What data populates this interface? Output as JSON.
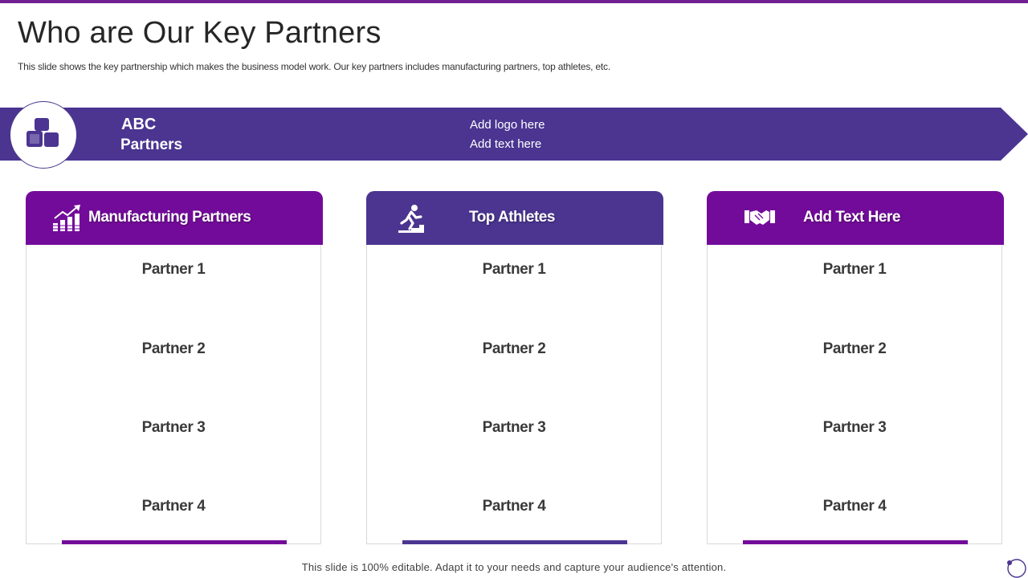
{
  "title": "Who are Our Key Partners",
  "subtitle": "This slide shows the key partnership which makes the business model work. Our key partners includes manufacturing partners, top athletes, etc.",
  "banner": {
    "name_line1": "ABC",
    "name_line2": "Partners",
    "logo_placeholder": "Add logo here",
    "text_placeholder": "Add text here",
    "icon": "blocks-icon",
    "color": "#4b3591"
  },
  "cards": [
    {
      "title": "Manufacturing Partners",
      "icon": "growth-chart-icon",
      "color": "#730b9a",
      "partners": [
        "Partner 1",
        "Partner 2",
        "Partner 3",
        "Partner 4"
      ]
    },
    {
      "title": "Top Athletes",
      "icon": "runner-icon",
      "color": "#4b3591",
      "partners": [
        "Partner 1",
        "Partner 2",
        "Partner 3",
        "Partner 4"
      ]
    },
    {
      "title": "Add Text Here",
      "icon": "handshake-icon",
      "color": "#730b9a",
      "partners": [
        "Partner 1",
        "Partner 2",
        "Partner 3",
        "Partner 4"
      ]
    }
  ],
  "footer": {
    "note": "This slide is 100% editable. Adapt it to your needs and capture your audience's attention."
  }
}
